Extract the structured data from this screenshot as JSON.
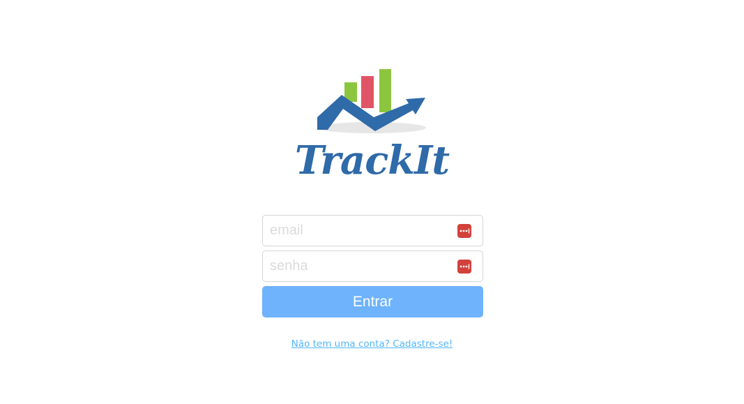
{
  "brand": {
    "name": "TrackIt",
    "logo_icon": "trackit-chart-logo",
    "colors": {
      "blue": "#2f6aa9",
      "green": "#8cc63f",
      "red": "#e05565",
      "shadow": "#e6e6e6"
    }
  },
  "login_form": {
    "email_placeholder": "email",
    "password_placeholder": "senha",
    "password_manager_icon": "password-manager-icon",
    "submit_label": "Entrar",
    "submit_color": "#6eb3fb"
  },
  "signup": {
    "link_text": "Não tem uma conta? Cadastre-se!",
    "link_color": "#52b6fe"
  }
}
